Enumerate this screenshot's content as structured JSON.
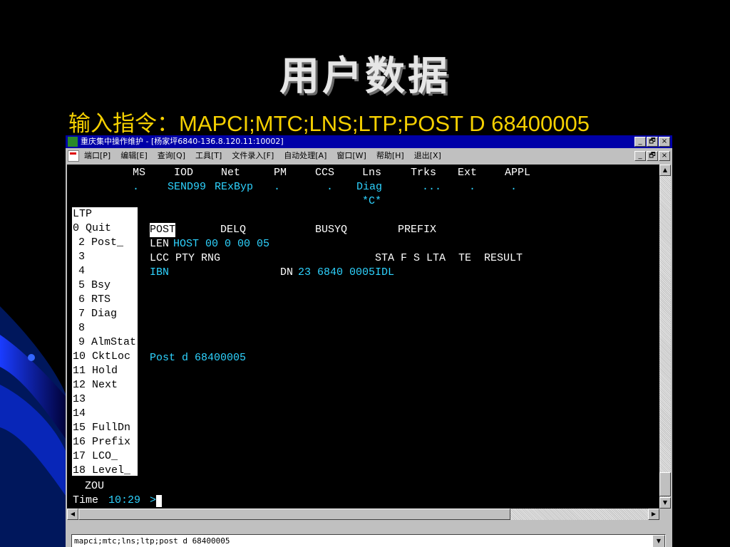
{
  "slide": {
    "title": "用户数据",
    "command_line": "输入指令：MAPCI;MTC;LNS;LTP;POST D  68400005"
  },
  "window": {
    "title": "重庆集中操作维护 - [杨家坪6840-136.8.120.11:10002]",
    "menu": [
      "端口[P]",
      "编辑[E]",
      "查询[Q]",
      "工具[T]",
      "文件录入[F]",
      "自动处理[A]",
      "窗口[W]",
      "帮助[H]",
      "退出[X]"
    ],
    "controls": {
      "minimize": "_",
      "restore": "🗗",
      "close": "×"
    }
  },
  "terminal": {
    "status_headers": [
      "MS",
      "IOD",
      "Net",
      "PM",
      "CCS",
      "Lns",
      "Trks",
      "Ext",
      "APPL"
    ],
    "status_values": [
      ".",
      "SEND99",
      "RExByp",
      ".",
      ".",
      "Diag",
      "...",
      ".",
      "."
    ],
    "lns_flag": "*C*",
    "ltp_menu": {
      "title": "LTP",
      "items": [
        "0 Quit",
        "2 Post_",
        "3",
        "4",
        "5 Bsy",
        "6 RTS",
        "7 Diag",
        "8",
        "9 AlmStat",
        "10 CktLoc",
        "11 Hold",
        "12 Next",
        "13",
        "14",
        "15 FullDn",
        "16 Prefix",
        "17 LCO_",
        "18 Level_"
      ]
    },
    "queue_labels": [
      "POST",
      "DELQ",
      "BUSYQ",
      "PREFIX"
    ],
    "len_label": "LEN",
    "len_value": "HOST 00 0 00 05",
    "line_headers_left": "LCC PTY RNG",
    "line_headers_right": "STA F S LTA  TE  RESULT",
    "lcc_value": "IBN",
    "dn_label": "DN",
    "dn_value": "23 6840 0005",
    "sta_value": "IDL",
    "post_echo": "Post d 68400005",
    "user": "ZOU",
    "time_label": "Time",
    "time_value": "10:29",
    "prompt": ">"
  },
  "command_input": {
    "value": "mapci;mtc;lns;ltp;post d 68400005"
  }
}
